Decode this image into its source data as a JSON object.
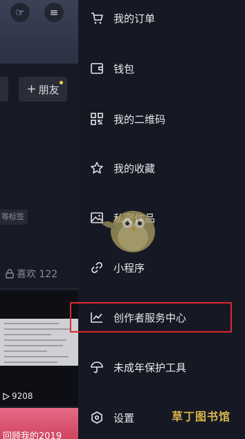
{
  "profile": {
    "add_friend_label": "朋友",
    "chip_label": "等标签",
    "likes_label": "喜欢 122",
    "video_views": "9208",
    "video_caption": "回顾我的2019"
  },
  "menu": {
    "items": [
      {
        "label": "我的订单",
        "icon": "cart-icon"
      },
      {
        "label": "钱包",
        "icon": "wallet-icon"
      },
      {
        "label": "我的二维码",
        "icon": "qr-code-icon"
      },
      {
        "label": "我的收藏",
        "icon": "star-icon"
      },
      {
        "label": "私密作品",
        "icon": "image-icon"
      },
      {
        "label": "小程序",
        "icon": "link-icon"
      },
      {
        "label": "创作者服务中心",
        "icon": "chart-icon"
      },
      {
        "label": "未成年保护工具",
        "icon": "umbrella-icon"
      },
      {
        "label": "设置",
        "icon": "hexagon-settings-icon"
      }
    ]
  },
  "colors": {
    "background": "#161823",
    "text": "#e8e9ec",
    "highlight": "#e0282f",
    "watermark": "#d8b74a"
  },
  "watermark": {
    "text": "草丁图书馆"
  }
}
